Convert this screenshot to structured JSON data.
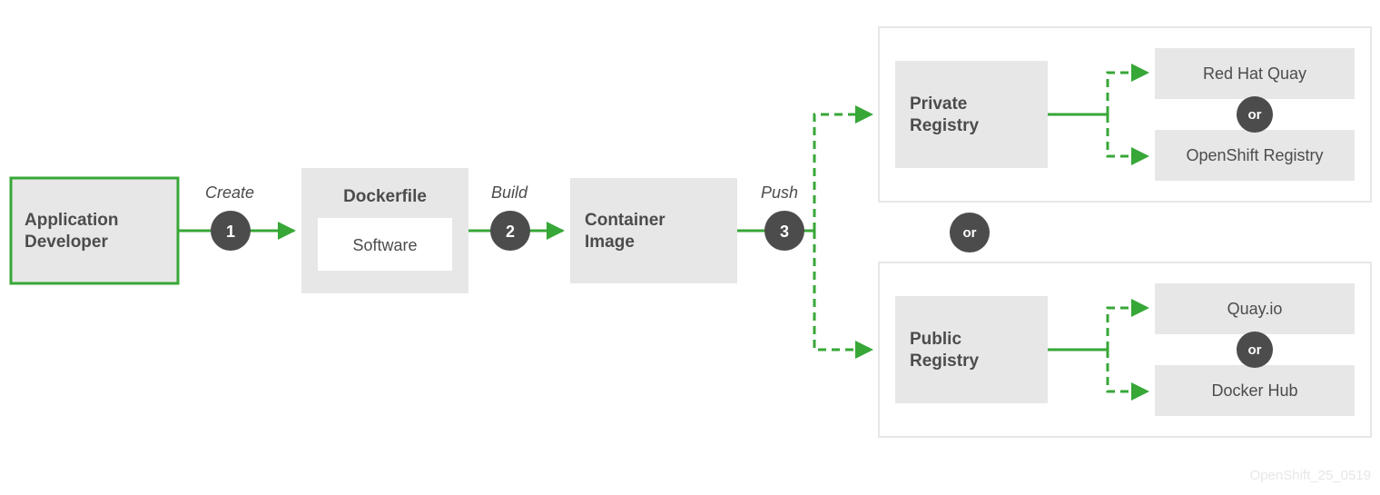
{
  "nodes": {
    "app_dev_l1": "Application",
    "app_dev_l2": "Developer",
    "dockerfile": "Dockerfile",
    "software": "Software",
    "container_l1": "Container",
    "container_l2": "Image",
    "private_l1": "Private",
    "private_l2": "Registry",
    "public_l1": "Public",
    "public_l2": "Registry",
    "redhat_quay": "Red Hat Quay",
    "openshift_registry": "OpenShift Registry",
    "quay_io": "Quay.io",
    "docker_hub": "Docker Hub"
  },
  "steps": {
    "s1_label": "Create",
    "s1_num": "1",
    "s2_label": "Build",
    "s2_num": "2",
    "s3_label": "Push",
    "s3_num": "3"
  },
  "or": "or",
  "footer": "OpenShift_25_0519",
  "colors": {
    "green": "#37a737",
    "gray_fill": "#e7e7e7",
    "light_border": "#e7e7e7",
    "dark_circle": "#4c4c4c",
    "text": "#4c4c4c"
  }
}
